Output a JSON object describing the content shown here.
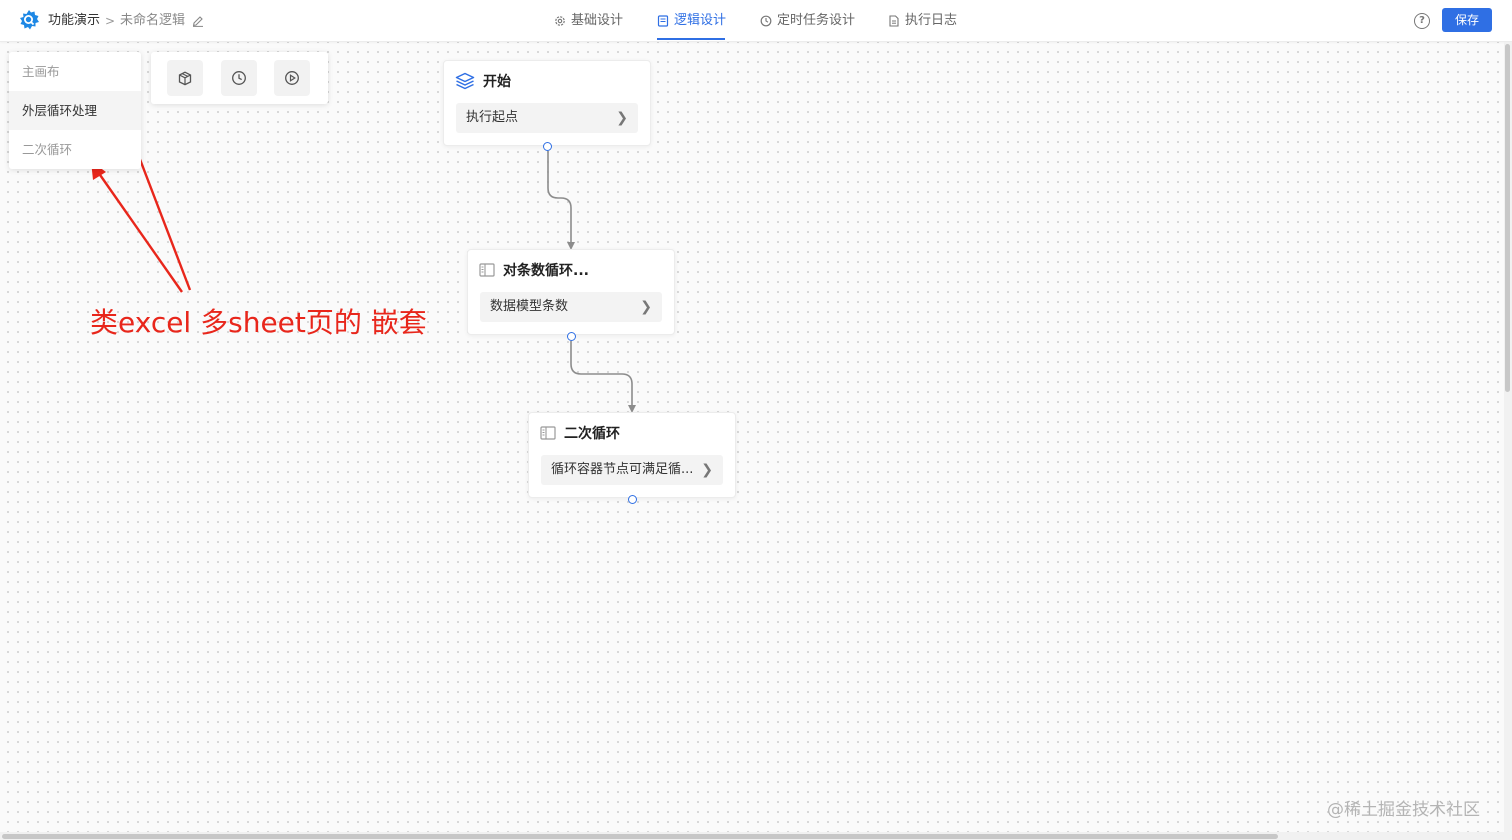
{
  "header": {
    "app_name": "功能演示",
    "breadcrumb_separator": ">",
    "doc_name": "未命名逻辑",
    "tabs": [
      {
        "label": "基础设计",
        "icon": "gear-icon",
        "active": false
      },
      {
        "label": "逻辑设计",
        "icon": "document-icon",
        "active": true
      },
      {
        "label": "定时任务设计",
        "icon": "clock-icon",
        "active": false
      },
      {
        "label": "执行日志",
        "icon": "file-icon",
        "active": false
      }
    ],
    "help_label": "?",
    "save_label": "保存"
  },
  "sheets": {
    "items": [
      {
        "label": "主画布",
        "active": false
      },
      {
        "label": "外层循环处理",
        "active": true
      },
      {
        "label": "二次循环",
        "active": false
      }
    ]
  },
  "toolbar": {
    "tools": [
      "package-icon",
      "clock-icon",
      "play-icon"
    ]
  },
  "nodes": [
    {
      "title": "开始",
      "icon": "layers-icon",
      "body": "执行起点"
    },
    {
      "title": "对条数循环...",
      "icon": "loop-container-icon",
      "body": "数据模型条数"
    },
    {
      "title": "二次循环",
      "icon": "loop-container-icon",
      "body": "循环容器节点可满足循..."
    }
  ],
  "annotation": "类excel 多sheet页的 嵌套",
  "watermark": "@稀土掘金技术社区",
  "colors": {
    "accent": "#2f6fe4",
    "annotation": "#e8261b",
    "edge": "#8c8c8c"
  }
}
